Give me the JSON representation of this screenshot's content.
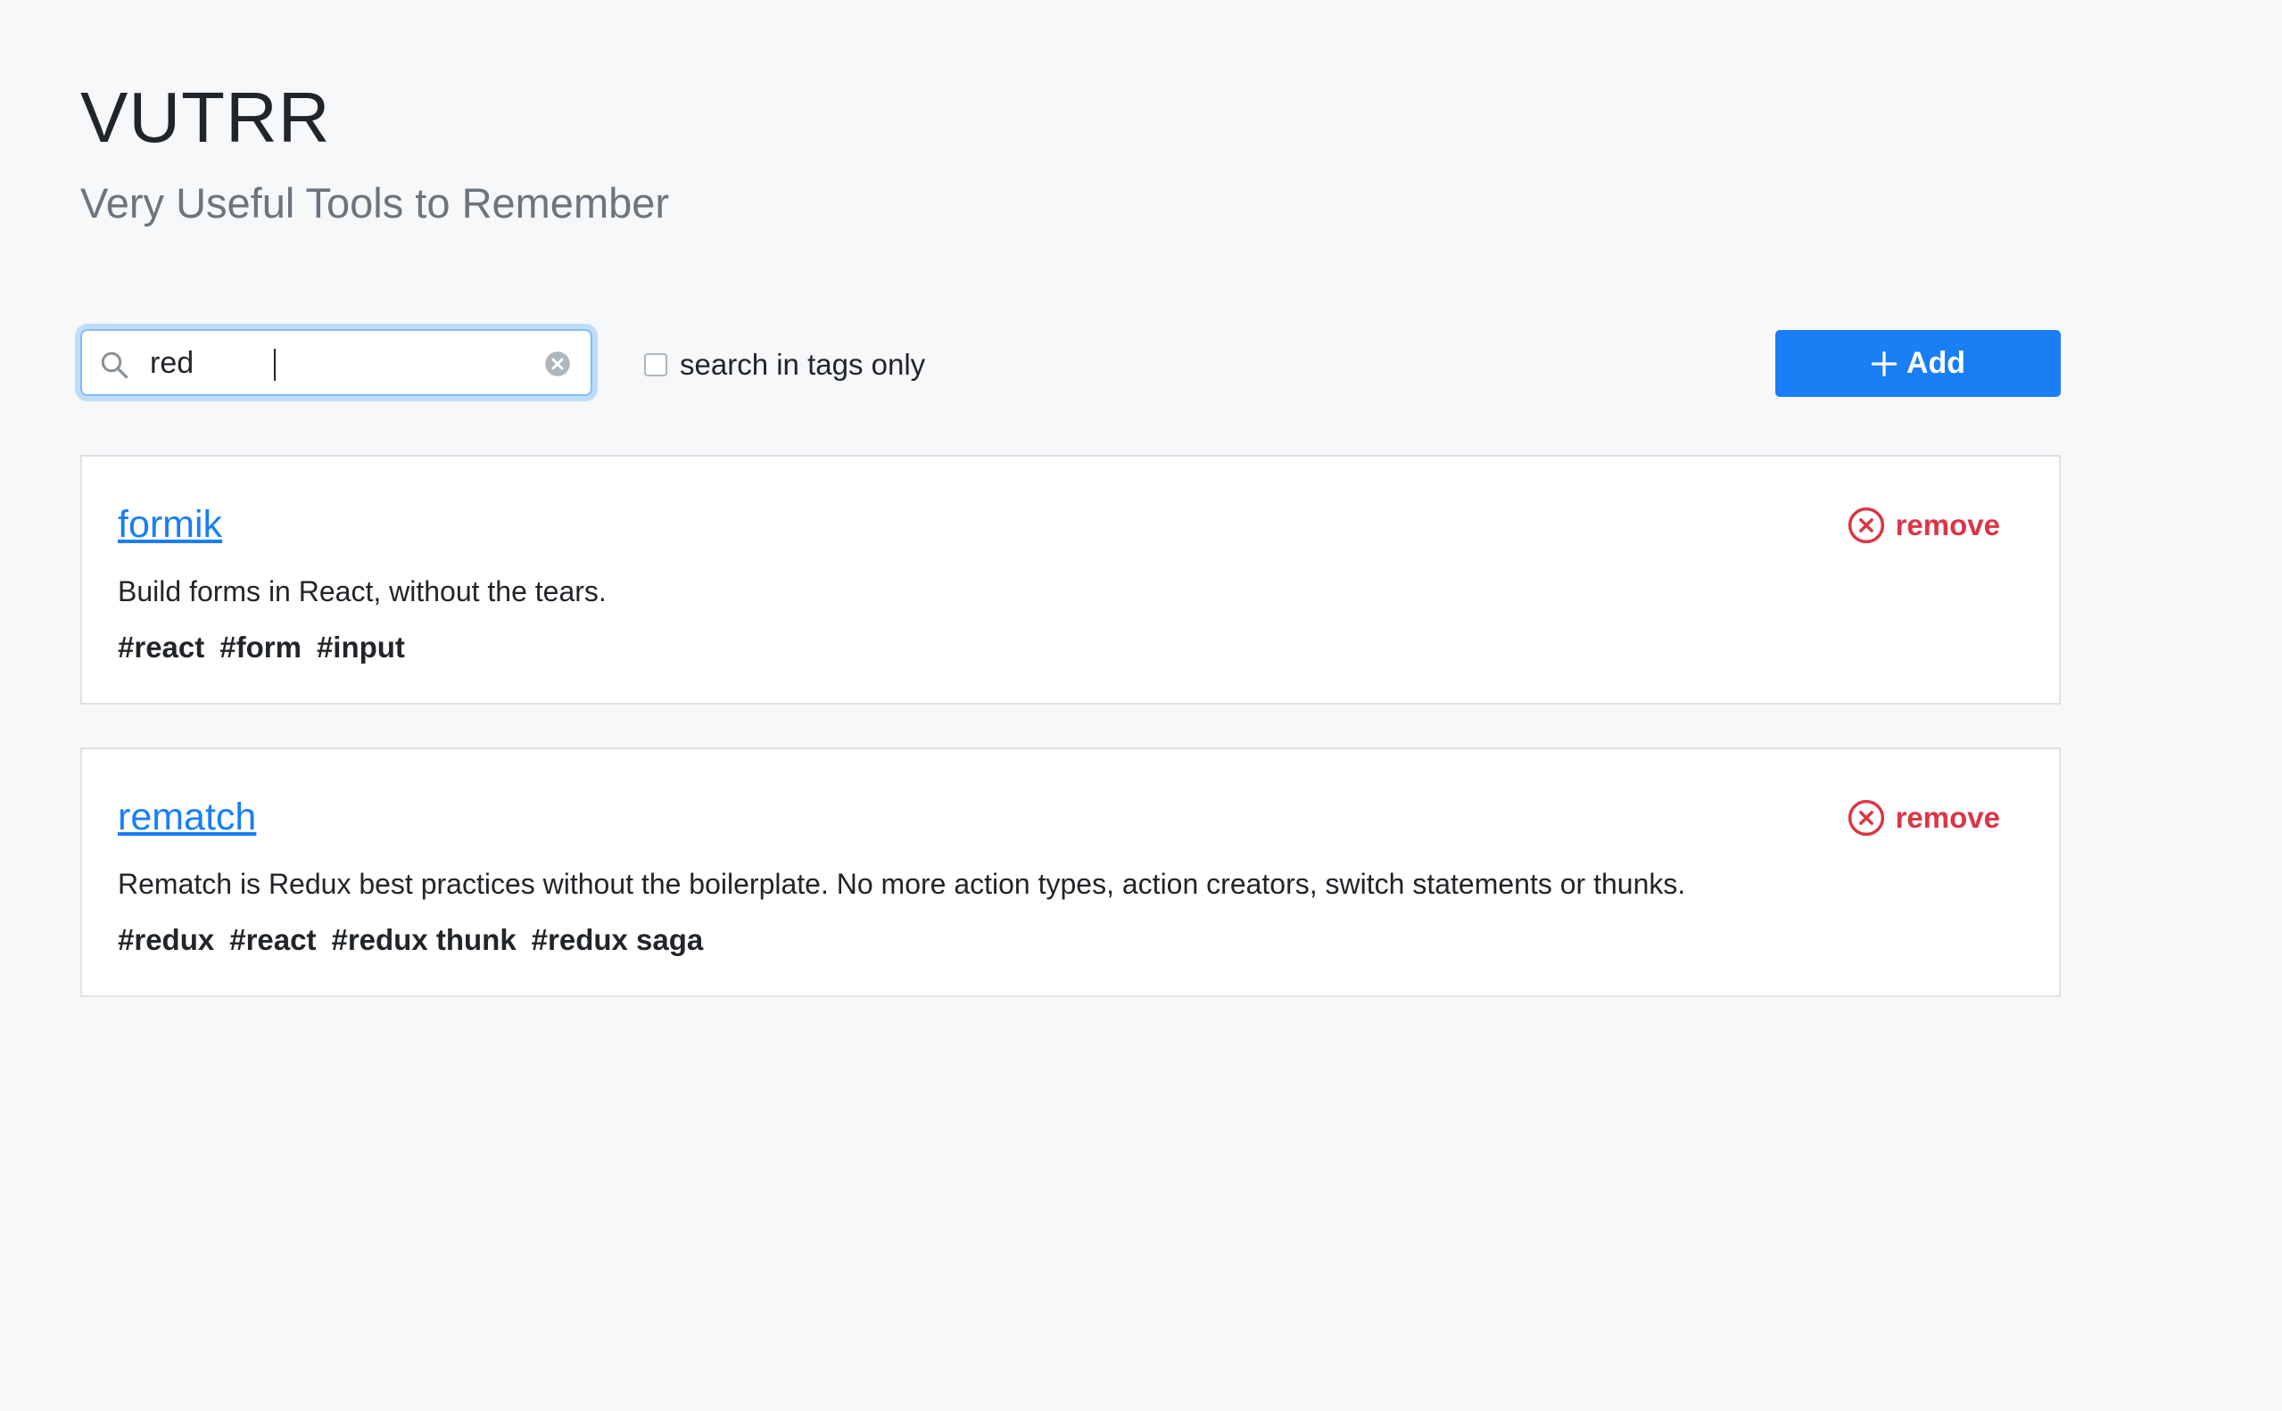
{
  "header": {
    "title": "VUTRR",
    "subtitle": "Very Useful Tools to Remember"
  },
  "search": {
    "value": "red",
    "icon": "search-icon",
    "clear_icon": "clear-circle-icon"
  },
  "filters": {
    "tags_only_label": "search in tags only",
    "tags_only_checked": false
  },
  "toolbar": {
    "add_label": "Add",
    "add_icon": "plus-icon",
    "accent": "#1a7ef5"
  },
  "tools": [
    {
      "name": "formik",
      "description": "Build forms in React, without the tears.",
      "tags": [
        "#react",
        "#form",
        "#input"
      ],
      "remove_label": "remove"
    },
    {
      "name": "rematch",
      "description": "Rematch is Redux best practices without the boilerplate. No more action types, action creators, switch statements or thunks.",
      "tags": [
        "#redux",
        "#react",
        "#redux thunk",
        "#redux saga"
      ],
      "remove_label": "remove"
    }
  ],
  "colors": {
    "danger": "#dc3545",
    "link": "#1a7ef5",
    "background": "#f7f8fa"
  }
}
